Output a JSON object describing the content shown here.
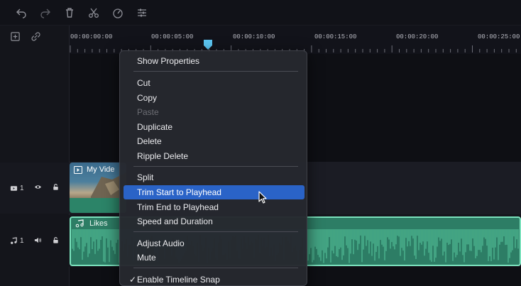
{
  "toolbar": {
    "icons": [
      "undo-icon",
      "redo-icon",
      "delete-icon",
      "cut-icon",
      "speed-icon",
      "adjust-icon"
    ]
  },
  "timeline_tools": {
    "icons": [
      "add-track-icon",
      "link-icon"
    ]
  },
  "ruler": {
    "labels": [
      "00:00:00:00",
      "00:00:05:00",
      "00:00:10:00",
      "00:00:15:00",
      "00:00:20:00",
      "00:00:25:00"
    ]
  },
  "tracks": {
    "video": {
      "index": "1",
      "icons": [
        "video-track-icon",
        "eye-icon",
        "lock-icon"
      ]
    },
    "audio": {
      "index": "1",
      "icons": [
        "music-track-icon",
        "speaker-icon",
        "lock-icon"
      ]
    }
  },
  "clips": {
    "video_title": "My Vide",
    "audio_title": "Likes"
  },
  "context_menu": {
    "show_properties": "Show Properties",
    "cut": "Cut",
    "copy": "Copy",
    "paste": "Paste",
    "duplicate": "Duplicate",
    "delete": "Delete",
    "ripple_delete": "Ripple Delete",
    "split": "Split",
    "trim_start": "Trim Start to Playhead",
    "trim_end": "Trim End to Playhead",
    "speed_duration": "Speed and Duration",
    "adjust_audio": "Adjust Audio",
    "mute": "Mute",
    "enable_snap": "Enable Timeline Snap",
    "check_mark": "✓"
  },
  "colors": {
    "menu_highlight": "#2a63c7",
    "audio_clip": "#2d7d65",
    "audio_border": "#7be2bd",
    "playhead": "#5cc6f2"
  }
}
